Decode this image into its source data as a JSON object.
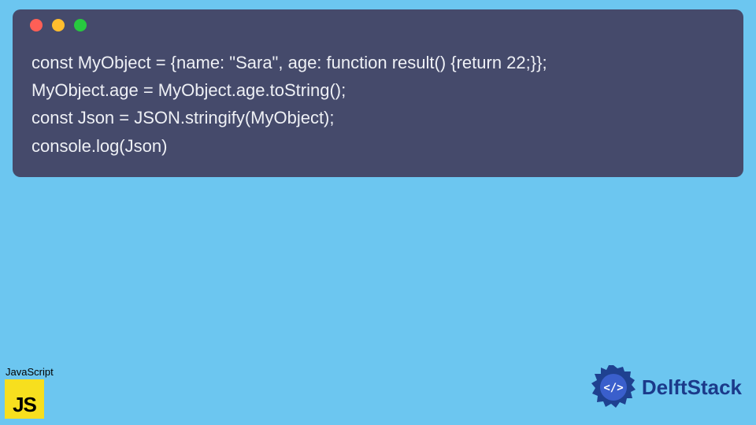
{
  "code": {
    "lines": [
      "const MyObject = {name: \"Sara\", age: function result() {return 22;}};",
      "MyObject.age = MyObject.age.toString();",
      "const Json = JSON.stringify(MyObject);",
      "console.log(Json)"
    ]
  },
  "jsBadge": {
    "label": "JavaScript",
    "iconText": "JS"
  },
  "delft": {
    "label": "DelftStack"
  }
}
